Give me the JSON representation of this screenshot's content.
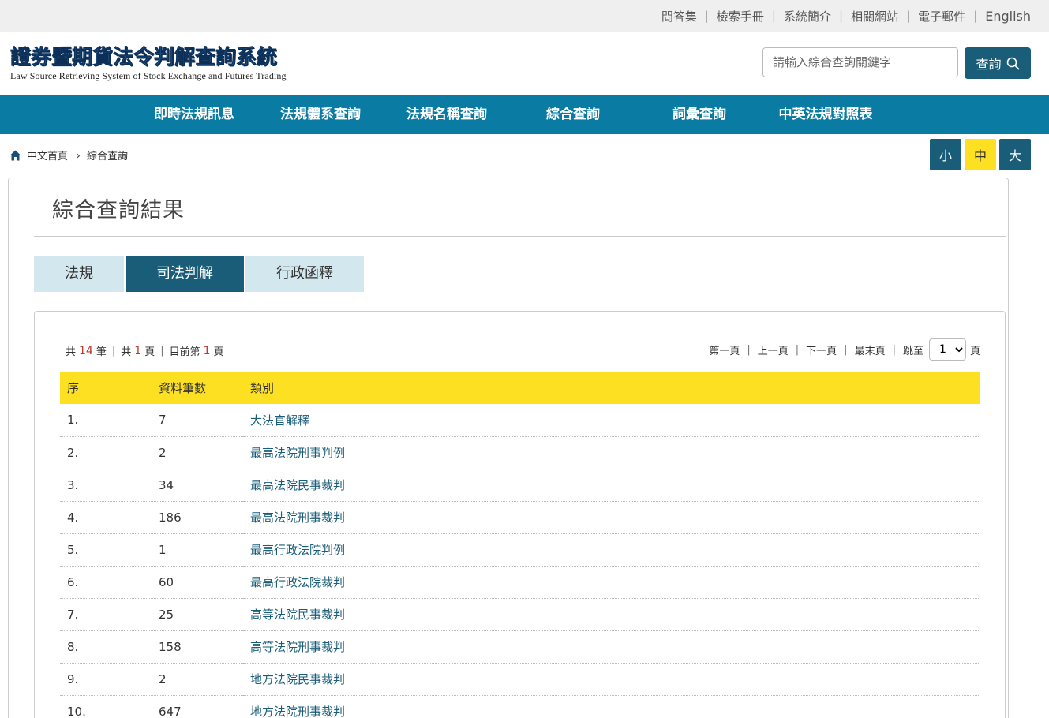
{
  "topbar": {
    "links": [
      "問答集",
      "檢索手冊",
      "系統簡介",
      "相關網站",
      "電子郵件"
    ],
    "english": "English"
  },
  "header": {
    "logo_zh": "證券暨期貨法令判解查詢系統",
    "logo_en": "Law Source Retrieving System of Stock Exchange and Futures Trading",
    "search_placeholder": "請輸入綜合查詢關鍵字",
    "search_label": "查詢"
  },
  "nav": {
    "items": [
      "即時法規訊息",
      "法規體系查詢",
      "法規名稱查詢",
      "綜合查詢",
      "詞彙查詢",
      "中英法規對照表"
    ]
  },
  "breadcrumb": {
    "home": "中文首頁",
    "current": "綜合查詢"
  },
  "font_size": {
    "small": "小",
    "medium": "中",
    "large": "大",
    "active": "中"
  },
  "page_title": "綜合查詢結果",
  "tabs": [
    {
      "label": "法規",
      "active": false
    },
    {
      "label": "司法判解",
      "active": true
    },
    {
      "label": "行政函釋",
      "active": false
    }
  ],
  "summary": {
    "prefix_total": "共",
    "total": "14",
    "unit_total": "筆",
    "prefix_pages": "共",
    "pages": "1",
    "unit_pages": "頁",
    "prefix_current": "目前第",
    "current": "1",
    "unit_current": "頁"
  },
  "pager": {
    "first": "第一頁",
    "prev": "上一頁",
    "next": "下一頁",
    "last": "最末頁",
    "goto": "跳至",
    "selected": "1",
    "unit": "頁"
  },
  "table": {
    "headers": [
      "序",
      "資料筆數",
      "類別"
    ],
    "rows": [
      [
        "1.",
        "7",
        "大法官解釋"
      ],
      [
        "2.",
        "2",
        "最高法院刑事判例"
      ],
      [
        "3.",
        "34",
        "最高法院民事裁判"
      ],
      [
        "4.",
        "186",
        "最高法院刑事裁判"
      ],
      [
        "5.",
        "1",
        "最高行政法院判例"
      ],
      [
        "6.",
        "60",
        "最高行政法院裁判"
      ],
      [
        "7.",
        "25",
        "高等法院民事裁判"
      ],
      [
        "8.",
        "158",
        "高等法院刑事裁判"
      ],
      [
        "9.",
        "2",
        "地方法院民事裁判"
      ],
      [
        "10.",
        "647",
        "地方法院刑事裁判"
      ]
    ]
  },
  "colors": {
    "nav_bg": "#0a7ba3",
    "dark_teal": "#1a5d79",
    "table_header": "#fde021",
    "tab_inactive": "#d3e8ee",
    "count_red": "#c0392b"
  }
}
